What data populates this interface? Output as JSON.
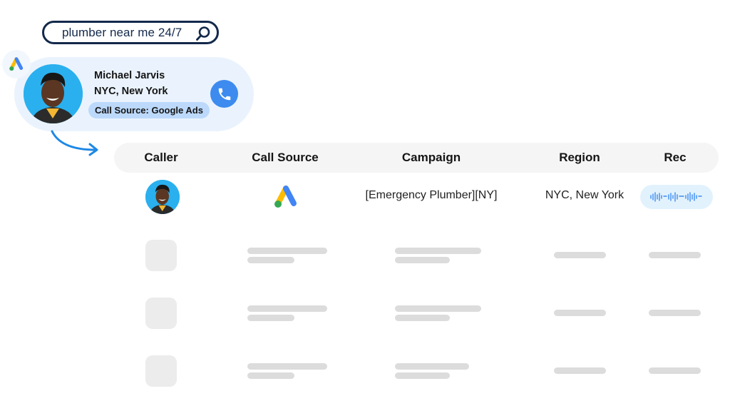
{
  "search": {
    "query": "plumber near me 24/7",
    "icon": "search-icon"
  },
  "caller_card": {
    "name": "Michael Jarvis",
    "location": "NYC, New York",
    "source_label": "Call Source: Google Ads",
    "badge_icon": "google-ads-icon",
    "action_icon": "phone-icon"
  },
  "table": {
    "columns": [
      "Caller",
      "Call Source",
      "Campaign",
      "Region",
      "Rec"
    ],
    "rows": [
      {
        "caller_icon": "avatar",
        "call_source_icon": "google-ads-icon",
        "campaign": "[Emergency Plumber][NY]",
        "region": "NYC, New York",
        "rec_icon": "audio-waveform-icon"
      }
    ],
    "placeholder_rows": 3
  },
  "colors": {
    "accent_blue": "#3d8bef",
    "search_border": "#13294b",
    "card_bg": "#eaf3fd",
    "pill_bg": "#bcd9fb",
    "header_bg": "#f5f5f5",
    "skeleton": "#dcdcdc"
  }
}
